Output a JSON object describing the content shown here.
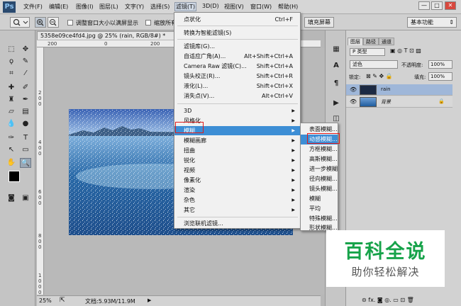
{
  "menubar": {
    "logo": "Ps",
    "items": [
      "文件(F)",
      "编辑(E)",
      "图像(I)",
      "图层(L)",
      "文字(Y)",
      "选择(S)",
      "滤镜(T)",
      "3D(D)",
      "视图(V)",
      "窗口(W)",
      "帮助(H)"
    ],
    "window_buttons": [
      "—",
      "□",
      "✕"
    ]
  },
  "options": {
    "check1_label": "调整窗口大小以满屏显示",
    "check2_label": "缩放所有",
    "fill_screen_button": "填充屏幕",
    "workspace": "基本功能"
  },
  "document": {
    "tab_title": "5358e09ce4fd4.jpg @ 25% (rain, RGB/8#) *",
    "ruler_h": [
      "200",
      "0",
      "200",
      "400"
    ],
    "ruler_v": [
      "2",
      "0",
      "0",
      "4",
      "0",
      "0",
      "6",
      "0",
      "0",
      "8",
      "0",
      "0",
      "1",
      "0",
      "0",
      "0"
    ]
  },
  "status": {
    "zoom": "25%",
    "doc_info": "文档:5.93M/11.9M"
  },
  "filter_menu": {
    "items": [
      {
        "label": "点状化",
        "shortcut": "Ctrl+F"
      },
      {
        "label": "转换为智能滤镜(S)"
      },
      {
        "label": "滤镜库(G)..."
      },
      {
        "label": "自适应广角(A)...",
        "shortcut": "Alt+Shift+Ctrl+A"
      },
      {
        "label": "Camera Raw 滤镜(C)...",
        "shortcut": "Shift+Ctrl+A"
      },
      {
        "label": "镜头校正(R)...",
        "shortcut": "Shift+Ctrl+R"
      },
      {
        "label": "液化(L)...",
        "shortcut": "Shift+Ctrl+X"
      },
      {
        "label": "消失点(V)...",
        "shortcut": "Alt+Ctrl+V"
      },
      {
        "label": "3D"
      },
      {
        "label": "风格化"
      },
      {
        "label": "模糊"
      },
      {
        "label": "模糊画廊"
      },
      {
        "label": "扭曲"
      },
      {
        "label": "锐化"
      },
      {
        "label": "视频"
      },
      {
        "label": "像素化"
      },
      {
        "label": "渲染"
      },
      {
        "label": "杂色"
      },
      {
        "label": "其它"
      },
      {
        "label": "浏览联机滤镜..."
      }
    ]
  },
  "blur_submenu": {
    "items": [
      "表面模糊...",
      "动感模糊...",
      "方框模糊...",
      "高斯模糊...",
      "进一步模糊",
      "径向模糊...",
      "镜头模糊...",
      "模糊",
      "平均",
      "特殊模糊...",
      "形状模糊..."
    ]
  },
  "layers_panel": {
    "tabs": [
      "图层",
      "路径",
      "通道"
    ],
    "kind_label": "P 类型",
    "blend_mode": "滤色",
    "opacity_label": "不透明度:",
    "opacity_value": "100%",
    "lock_label": "锁定:",
    "fill_label": "填充:",
    "fill_value": "100%",
    "layers": [
      {
        "name": "rain"
      },
      {
        "name": "背景"
      }
    ],
    "bottom_icons": "⊝  fx.  ◙  ◎.  ▭  ⊡  🗑"
  },
  "watermark": {
    "title": "百科全说",
    "subtitle": "助你轻松解决"
  }
}
